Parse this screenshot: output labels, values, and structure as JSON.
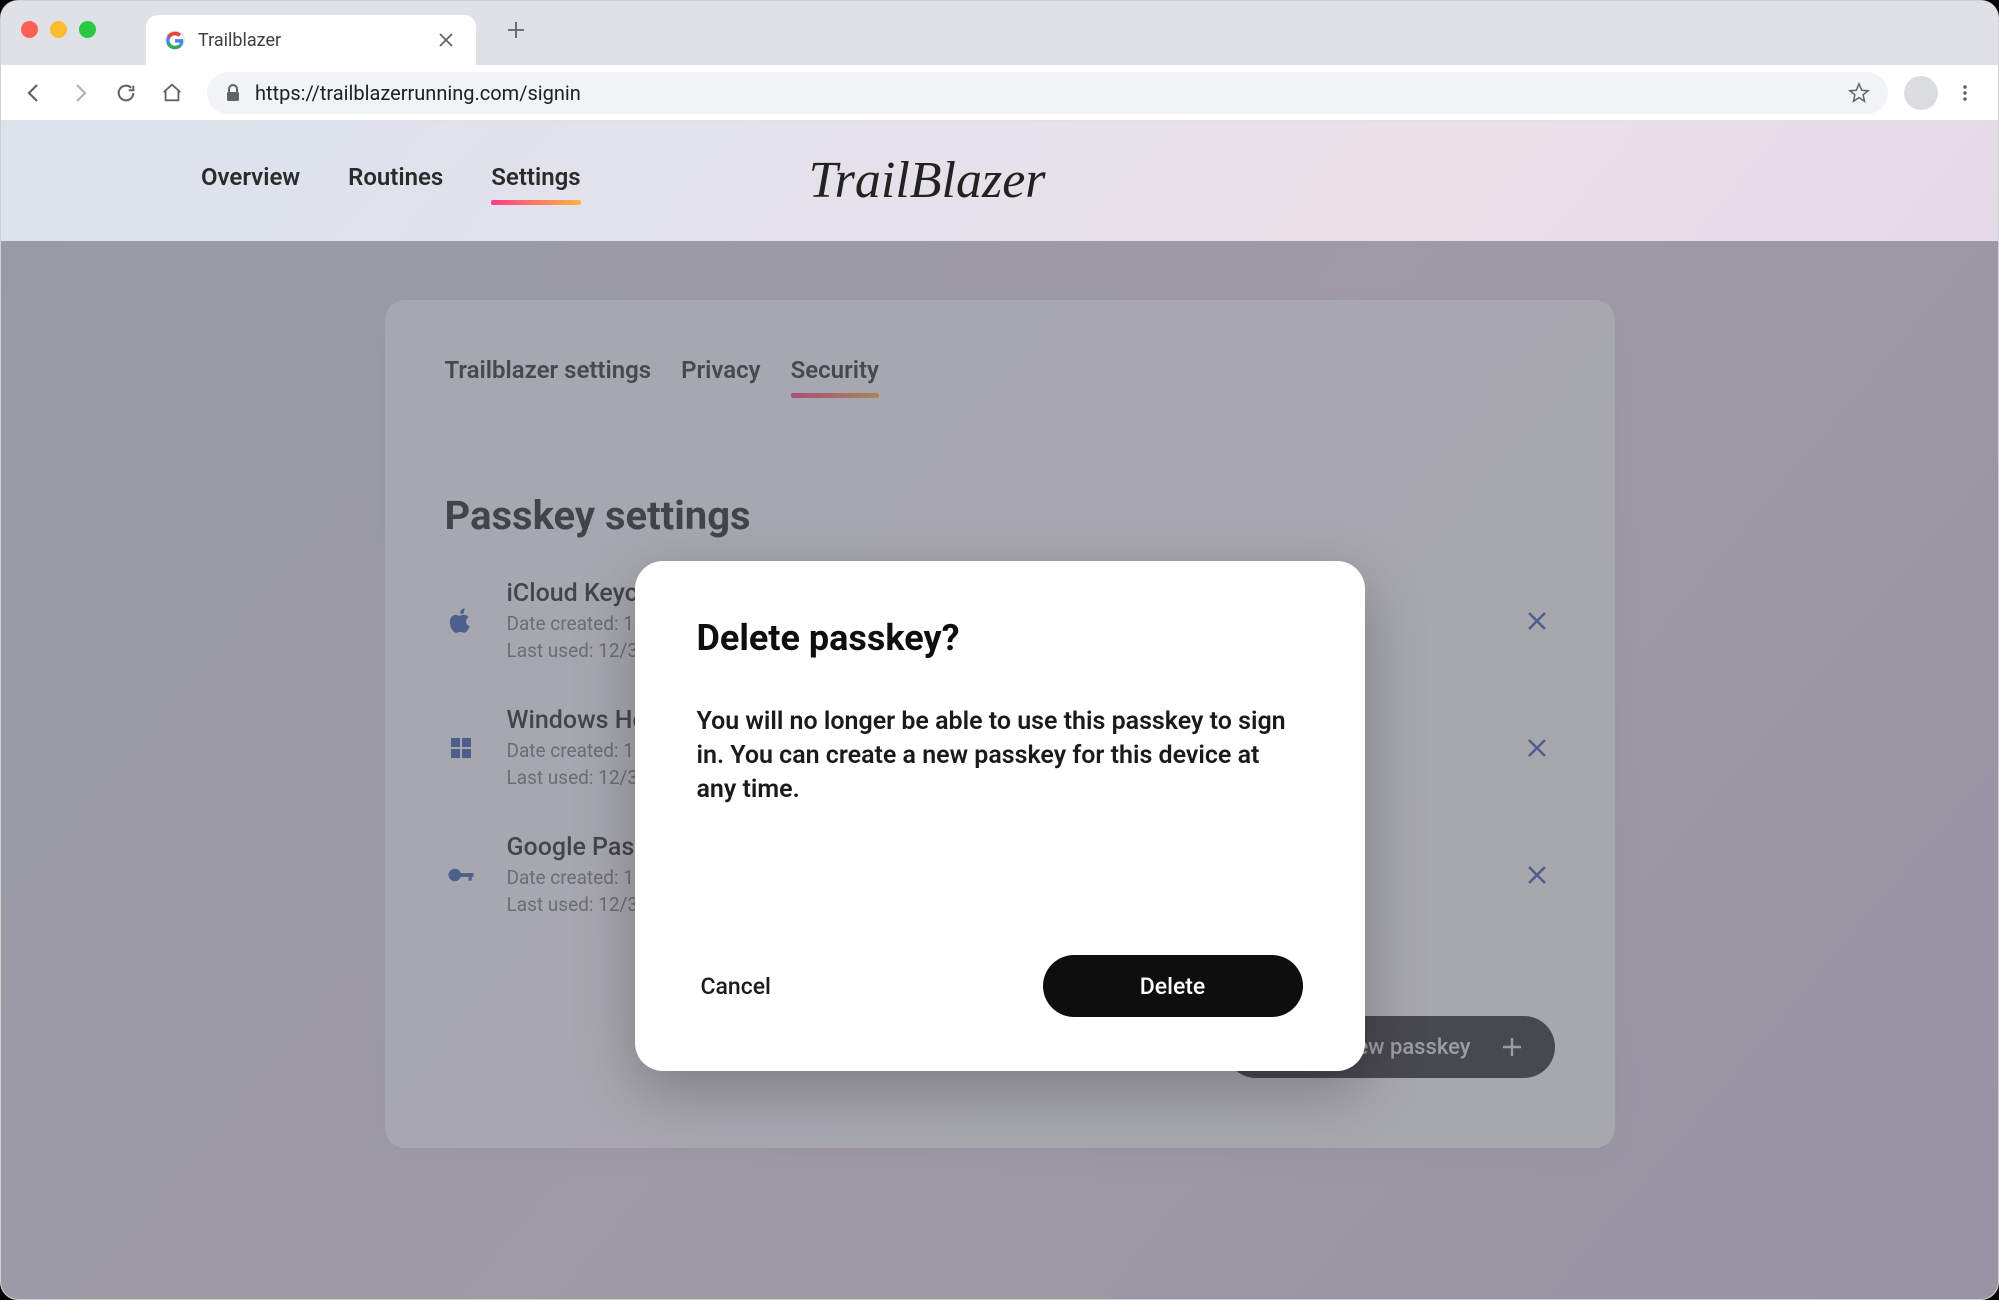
{
  "browser": {
    "tab_title": "Trailblazer",
    "url": "https://trailblazerrunning.com/signin"
  },
  "nav": {
    "items": [
      "Overview",
      "Routines",
      "Settings"
    ],
    "active_index": 2,
    "brand": "TrailBlazer"
  },
  "settings": {
    "tabs": [
      "Trailblazer settings",
      "Privacy",
      "Security"
    ],
    "active_tab_index": 2,
    "section_title": "Passkey settings",
    "passkeys": [
      {
        "icon": "apple",
        "name": "iCloud Keychain",
        "created_label": "Date created: 1",
        "last_used_label": "Last used: 12/3"
      },
      {
        "icon": "windows",
        "name": "Windows Hello",
        "created_label": "Date created: 1",
        "last_used_label": "Last used: 12/3"
      },
      {
        "icon": "key",
        "name": "Google Password Manager",
        "created_label": "Date created: 1",
        "last_used_label": "Last used: 12/3"
      }
    ],
    "create_button_label": "Create a new passkey"
  },
  "dialog": {
    "title": "Delete passkey?",
    "body": "You will no longer be able to use this passkey to sign in. You can create a new passkey for this device at any time.",
    "cancel_label": "Cancel",
    "confirm_label": "Delete"
  }
}
